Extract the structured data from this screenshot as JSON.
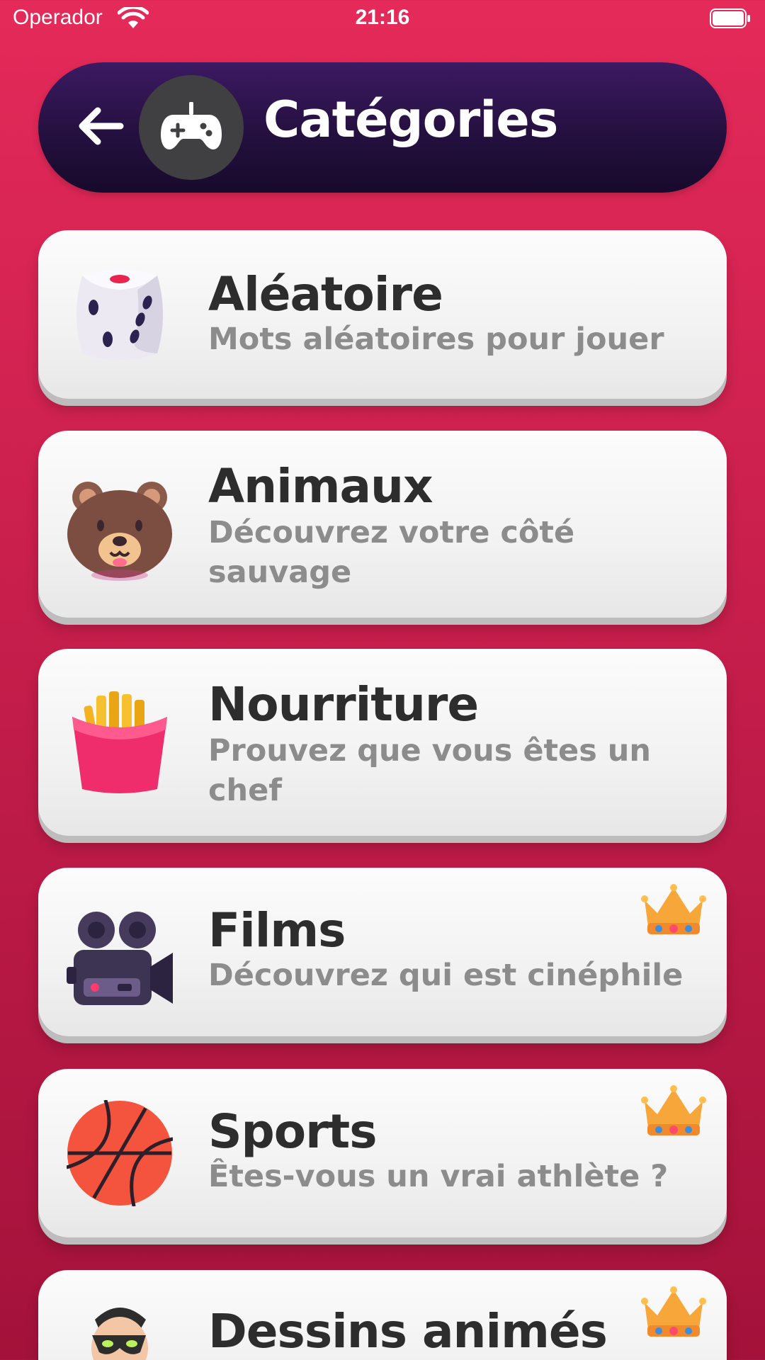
{
  "status_bar": {
    "carrier": "Operador",
    "time": "21:16"
  },
  "header": {
    "title": "Catégories",
    "back_icon": "arrow-left-icon",
    "logo_icon": "gamepad-icon"
  },
  "categories": [
    {
      "title": "Aléatoire",
      "subtitle": "Mots aléatoires pour jouer",
      "icon": "dice-icon",
      "premium": false
    },
    {
      "title": "Animaux",
      "subtitle": "Découvrez votre côté sauvage",
      "icon": "bear-icon",
      "premium": false
    },
    {
      "title": "Nourriture",
      "subtitle": "Prouvez que vous êtes un chef",
      "icon": "fries-icon",
      "premium": false
    },
    {
      "title": "Films",
      "subtitle": "Découvrez qui est cinéphile",
      "icon": "movie-camera-icon",
      "premium": true
    },
    {
      "title": "Sports",
      "subtitle": "Êtes-vous un vrai athlète ?",
      "icon": "basketball-icon",
      "premium": true
    },
    {
      "title": "Dessins animés",
      "subtitle": "",
      "icon": "cartoon-character-icon",
      "premium": true
    }
  ],
  "colors": {
    "background": "#d8244f",
    "header": "#24103f",
    "card": "#f5f5f5",
    "title_text": "#2d2d2d",
    "subtitle_text": "#8c8c8c"
  }
}
